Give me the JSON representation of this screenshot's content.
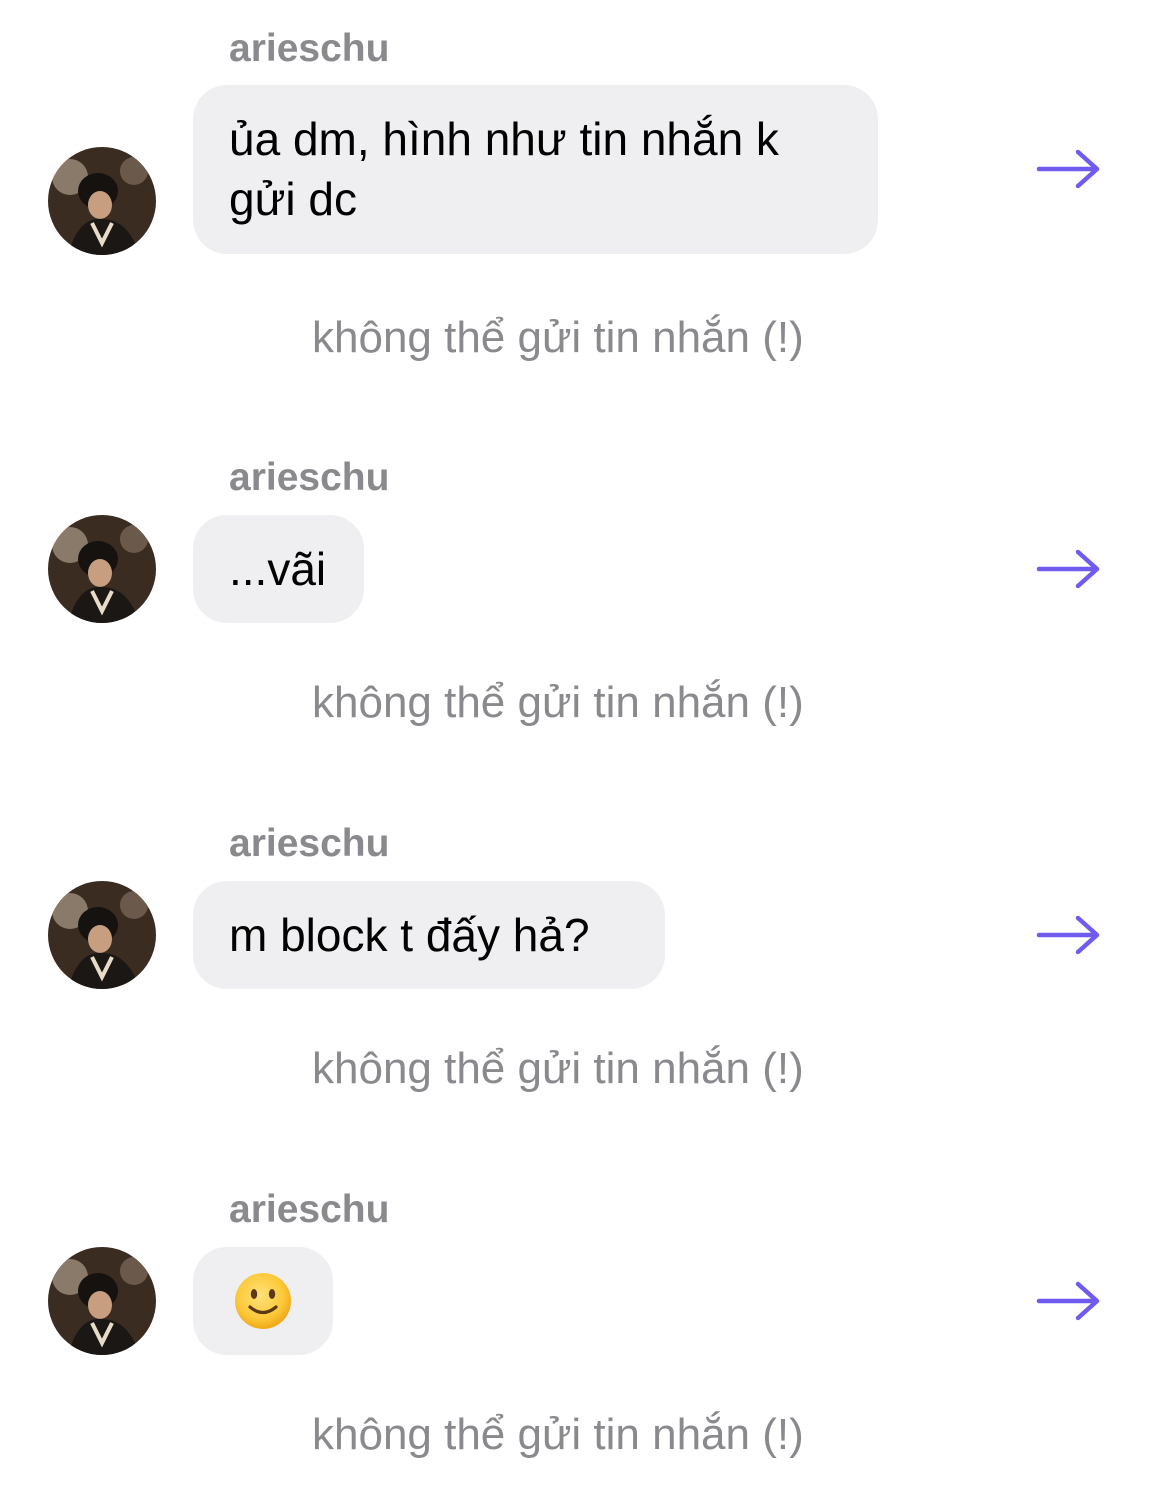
{
  "conversation": {
    "accent_color": "#6f5bf0",
    "messages": [
      {
        "sender": "arieschu",
        "text": "ủa dm, hình như tin nhắn k gửi dc",
        "status": "không thể gửi tin nhắn (!)"
      },
      {
        "sender": "arieschu",
        "text": "...vãi",
        "status": "không thể gửi tin nhắn (!)"
      },
      {
        "sender": "arieschu",
        "text": "m block t đấy hả?",
        "status": "không thể gửi tin nhắn (!)"
      },
      {
        "sender": "arieschu",
        "emoji": "slightly-smiling-face",
        "status": "không thể gửi tin nhắn (!)"
      }
    ],
    "icons": {
      "reply": "arrow-right-icon",
      "avatar": "user-avatar"
    }
  }
}
